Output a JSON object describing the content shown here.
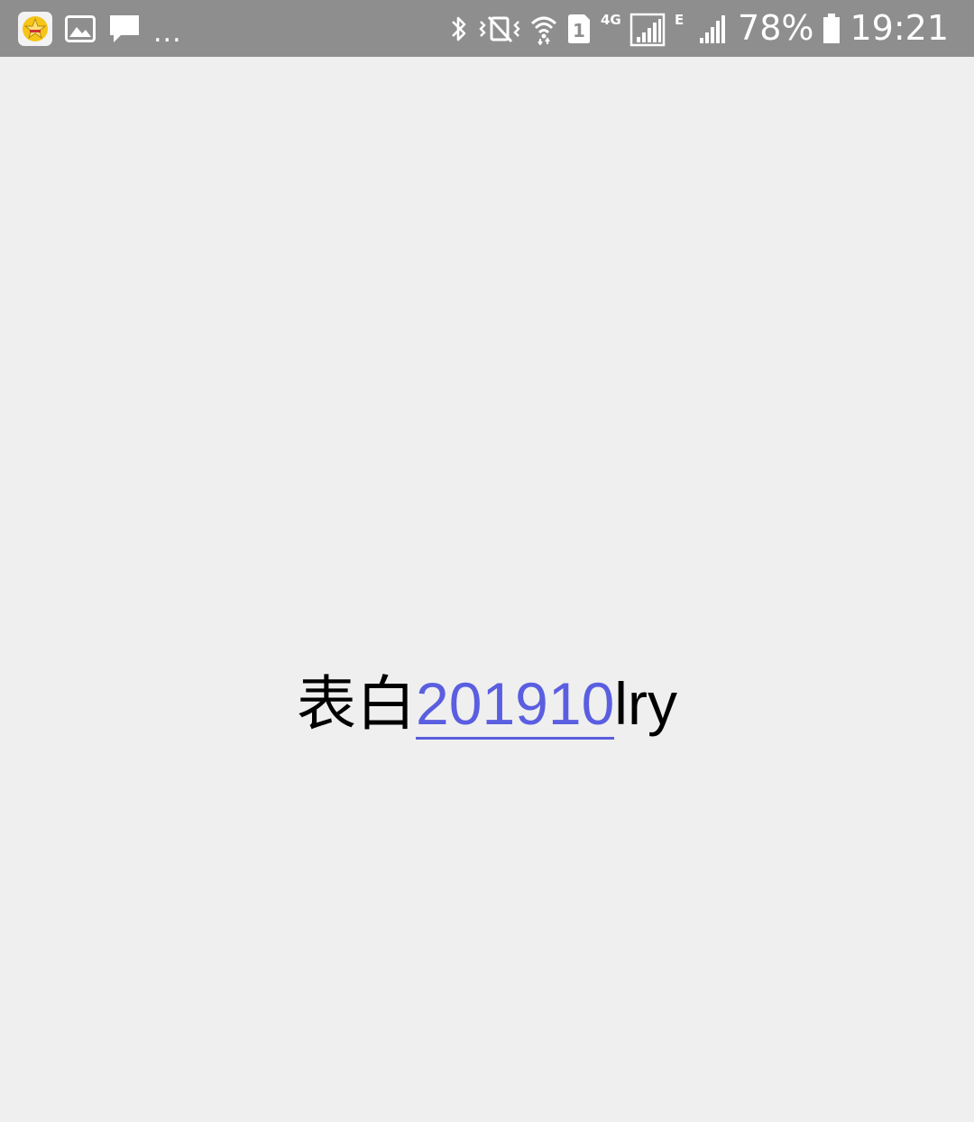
{
  "status_bar": {
    "notification_icons": [
      "qq-app-icon",
      "gallery-icon",
      "chat-icon"
    ],
    "more_indicator": "...",
    "system_icons": [
      "bluetooth-icon",
      "vibrate-icon",
      "wifi-icon",
      "sim-1-icon",
      "4g-signal-icon",
      "edge-signal-icon",
      "battery-icon"
    ],
    "network_4g_label": "4G",
    "network_edge_label": "E",
    "sim_label": "1",
    "battery_percent": "78%",
    "battery_level": 0.78,
    "time": "19:21"
  },
  "content": {
    "prefix": "表白",
    "link_text": "201910",
    "suffix": "lry",
    "link_color": "#5a5ee0"
  },
  "colors": {
    "status_bar_bg": "#8e8e8e",
    "page_bg": "#efefef"
  }
}
